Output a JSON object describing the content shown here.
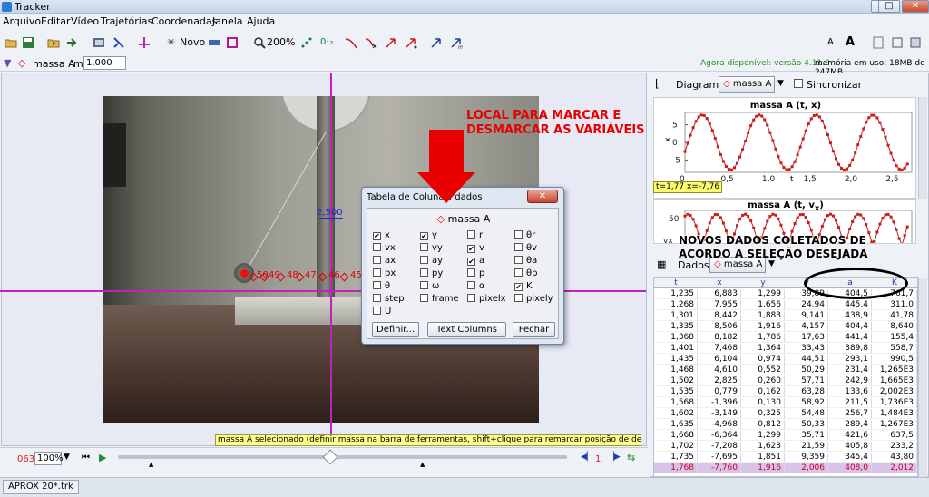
{
  "window": {
    "title": "Tracker",
    "minimize": "–",
    "maximize": "□",
    "close": "✕"
  },
  "menu": [
    "Arquivo",
    "Editar",
    "Vídeo",
    "Trajetórias",
    "Coordenadas",
    "Janela",
    "Ajuda"
  ],
  "toolbar": {
    "new_label": "Novo",
    "zoom_label": "200%",
    "font_smaller": "A",
    "font_larger": "A"
  },
  "trackbar": {
    "track_name": "massa A",
    "mass_label": "m",
    "mass_value": "1,000",
    "update_notice": "Agora disponível: versão 4.11.0",
    "memory": "memória em uso: 18MB de 247MB"
  },
  "video": {
    "calibration_value": "2,500",
    "marks": [
      "50",
      "49",
      "48",
      "47",
      "46",
      "45"
    ]
  },
  "annotations": {
    "mark_vars": "LOCAL PARA MARCAR E DESMARCAR AS VARIÁVEIS",
    "new_data": "NOVOS DADOS COLETADOS DE ACORDO A SELEÇÃO DESEJADA"
  },
  "dialog": {
    "title": "Tabela de Colunas: dados",
    "track": "massa A",
    "close": "✕",
    "columns": [
      [
        {
          "label": "x",
          "checked": true
        },
        {
          "label": "vx",
          "checked": false
        },
        {
          "label": "ax",
          "checked": false
        },
        {
          "label": "px",
          "checked": false
        },
        {
          "label": "θ",
          "checked": false
        },
        {
          "label": "step",
          "checked": false
        },
        {
          "label": "U",
          "checked": false
        }
      ],
      [
        {
          "label": "y",
          "checked": true
        },
        {
          "label": "vy",
          "checked": false
        },
        {
          "label": "ay",
          "checked": false
        },
        {
          "label": "py",
          "checked": false
        },
        {
          "label": "ω",
          "checked": false
        },
        {
          "label": "frame",
          "checked": false
        }
      ],
      [
        {
          "label": "r",
          "checked": false
        },
        {
          "label": "v",
          "checked": true
        },
        {
          "label": "a",
          "checked": true
        },
        {
          "label": "p",
          "checked": false
        },
        {
          "label": "α",
          "checked": false
        },
        {
          "label": "pixelx",
          "checked": false
        }
      ],
      [
        {
          "label": "θr",
          "checked": false
        },
        {
          "label": "θv",
          "checked": false
        },
        {
          "label": "θa",
          "checked": false
        },
        {
          "label": "θp",
          "checked": false
        },
        {
          "label": "K",
          "checked": true
        },
        {
          "label": "pixely",
          "checked": false
        }
      ]
    ],
    "buttons": {
      "define": "Definir...",
      "text_columns": "Text Columns",
      "close": "Fechar"
    }
  },
  "status": {
    "message": "massa A selecionado (definir massa na barra de ferramentas, shift+clique para remarcar posição de destaque)"
  },
  "player": {
    "frame": "063",
    "zoom": "100%",
    "step": "1"
  },
  "file_tab": "APROX 20*.trk",
  "right_panel": {
    "diagram_label": "Diagrama",
    "track_label": "massa A",
    "sync_label": "Sincronizar",
    "plot1": {
      "title": "massa A (t, x)",
      "xlabel": "t",
      "ylabel": "x",
      "readout": "t=1,77  x=-7,76"
    },
    "plot2": {
      "title": "massa A (t, v",
      "title_sub": "x",
      "title_end": ")"
    },
    "data_label": "Dados",
    "data_track": "massa A"
  },
  "chart_data": [
    {
      "type": "line",
      "title": "massa A (t, x)",
      "xlabel": "t",
      "ylabel": "x",
      "xlim": [
        0,
        2.75
      ],
      "ylim": [
        -8.5,
        8.5
      ],
      "x_ticks": [
        "0",
        "0,5",
        "1,0",
        "1,5",
        "2,0",
        "2,5"
      ],
      "y_ticks": [
        "5",
        "0",
        "-5"
      ],
      "amplitude": 7.8,
      "period": 0.69,
      "phase_peak_t": 0.21
    },
    {
      "type": "line",
      "title": "massa A (t, vx)",
      "ylabel": "vx",
      "y_ticks": [
        "50",
        "0"
      ]
    }
  ],
  "table": {
    "headers": [
      "t",
      "x",
      "y",
      "v",
      "a",
      "K"
    ],
    "rows": [
      [
        "1,235",
        "6,883",
        "1,299",
        "39,89",
        "404,5",
        "761,7"
      ],
      [
        "1,268",
        "7,955",
        "1,656",
        "24,94",
        "445,4",
        "311,0"
      ],
      [
        "1,301",
        "8,442",
        "1,883",
        "9,141",
        "438,9",
        "41,78"
      ],
      [
        "1,335",
        "8,506",
        "1,916",
        "4,157",
        "404,4",
        "8,640"
      ],
      [
        "1,368",
        "8,182",
        "1,786",
        "17,63",
        "441,4",
        "155,4"
      ],
      [
        "1,401",
        "7,468",
        "1,364",
        "33,43",
        "389,8",
        "558,7"
      ],
      [
        "1,435",
        "6,104",
        "0,974",
        "44,51",
        "293,1",
        "990,5"
      ],
      [
        "1,468",
        "4,610",
        "0,552",
        "50,29",
        "231,4",
        "1,265E3"
      ],
      [
        "1,502",
        "2,825",
        "0,260",
        "57,71",
        "242,9",
        "1,665E3"
      ],
      [
        "1,535",
        "0,779",
        "0,162",
        "63,28",
        "133,6",
        "2,002E3"
      ],
      [
        "1,568",
        "-1,396",
        "0,130",
        "58,92",
        "211,5",
        "1,736E3"
      ],
      [
        "1,602",
        "-3,149",
        "0,325",
        "54,48",
        "256,7",
        "1,484E3"
      ],
      [
        "1,635",
        "-4,968",
        "0,812",
        "50,33",
        "289,4",
        "1,267E3"
      ],
      [
        "1,668",
        "-6,364",
        "1,299",
        "35,71",
        "421,6",
        "637,5"
      ],
      [
        "1,702",
        "-7,208",
        "1,623",
        "21,59",
        "405,8",
        "233,2"
      ],
      [
        "1,735",
        "-7,695",
        "1,851",
        "9,359",
        "345,4",
        "43,80"
      ],
      [
        "1,768",
        "-7,760",
        "1,916",
        "2,006",
        "408,0",
        "2,012"
      ]
    ]
  }
}
